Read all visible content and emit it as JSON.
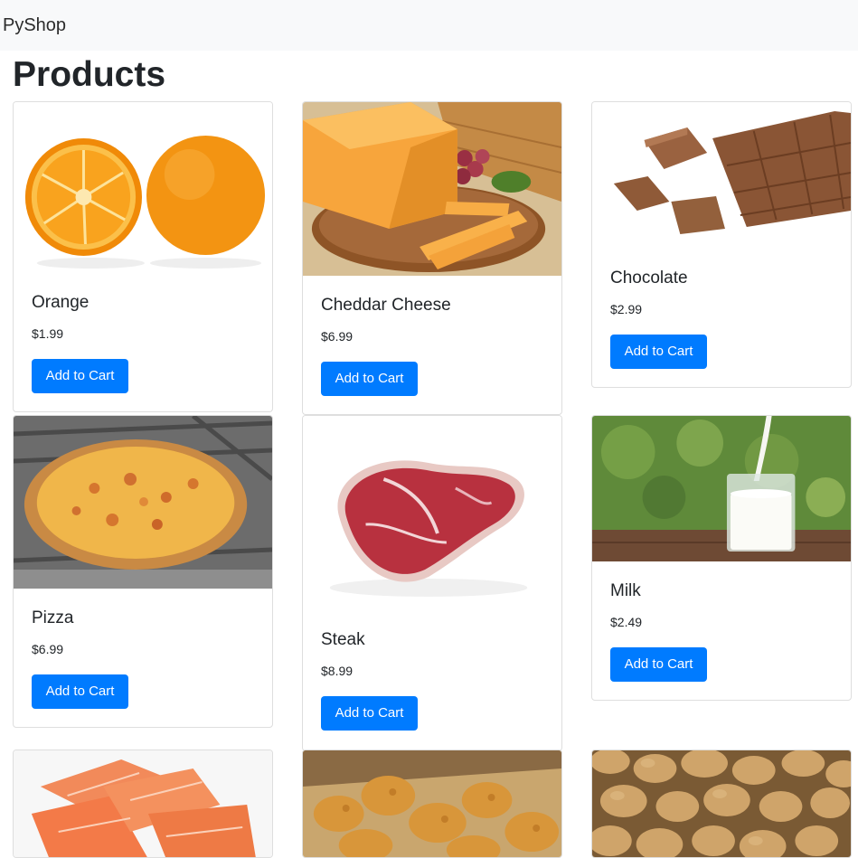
{
  "navbar": {
    "brand": "PyShop"
  },
  "page": {
    "title": "Products"
  },
  "products": [
    {
      "name": "Orange",
      "price": "$1.99",
      "button": "Add to Cart"
    },
    {
      "name": "Cheddar Cheese",
      "price": "$6.99",
      "button": "Add to Cart"
    },
    {
      "name": "Chocolate",
      "price": "$2.99",
      "button": "Add to Cart"
    },
    {
      "name": "Pizza",
      "price": "$6.99",
      "button": "Add to Cart"
    },
    {
      "name": "Steak",
      "price": "$8.99",
      "button": "Add to Cart"
    },
    {
      "name": "Milk",
      "price": "$2.49",
      "button": "Add to Cart"
    }
  ],
  "colors": {
    "primary": "#007bff",
    "navbar_bg": "#f8f9fa"
  }
}
